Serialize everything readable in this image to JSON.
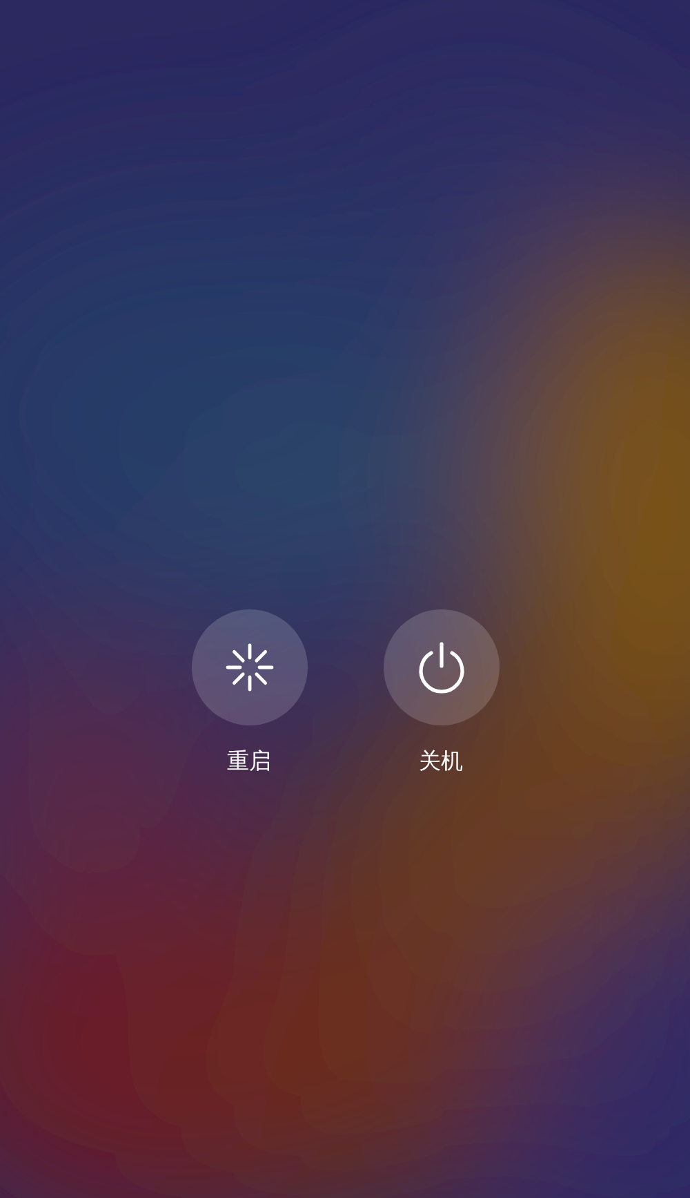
{
  "buttons": [
    {
      "kind": "restart",
      "label": "重启"
    },
    {
      "kind": "power",
      "label": "关机"
    }
  ]
}
